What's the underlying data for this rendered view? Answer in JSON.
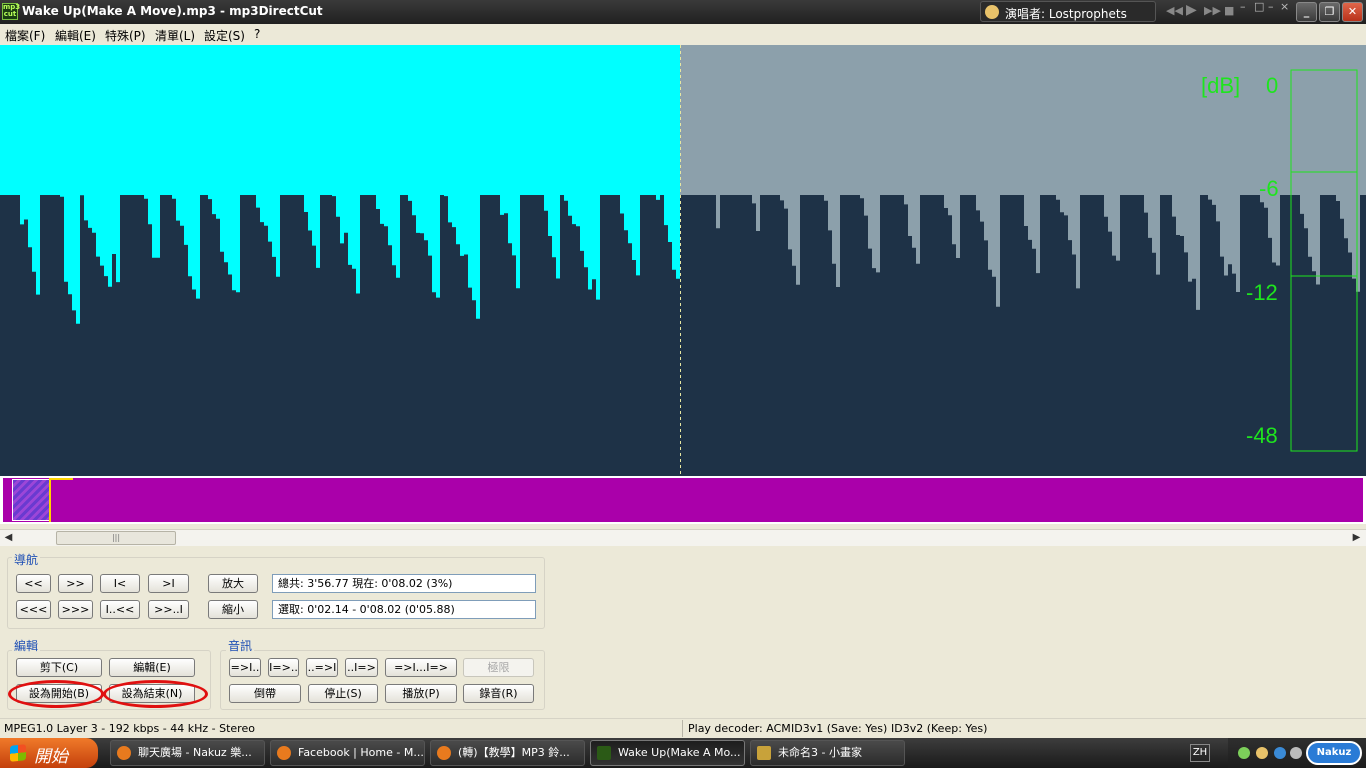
{
  "window": {
    "title": "Wake Up(Make A Move).mp3 - mp3DirectCut",
    "app_icon_text": "mp3 cut"
  },
  "now_playing": {
    "text": "演唱者: Lostprophets"
  },
  "menu": [
    "檔案(F)",
    "編輯(E)",
    "特殊(P)",
    "清單(L)",
    "設定(S)",
    "?"
  ],
  "waveform": {
    "played_color": "#00ffff",
    "unplayed_color": "#8ca0ab",
    "wave_color": "#1e3247",
    "meter_color": "#1ee51e",
    "db_labels": [
      "[dB]",
      "0",
      "-6",
      "-12",
      "-48"
    ]
  },
  "overview": {
    "bar_color": "#aa00aa"
  },
  "navigation": {
    "label": "導航",
    "row1": [
      "<<",
      ">>",
      "I<",
      ">I"
    ],
    "row2": [
      "<<<",
      ">>>",
      "I..<<",
      ">>..I"
    ],
    "zoom_in": "放大",
    "zoom_out": "縮小",
    "total_info": "總共: 3'56.77   現在: 0'08.02   (3%)",
    "selection_info": "選取: 0'02.14 - 0'08.02 (0'05.88)"
  },
  "edit": {
    "label": "編輯",
    "cut": "剪下(C)",
    "edit": "編輯(E)",
    "set_start": "設為開始(B)",
    "set_end": "設為結束(N)"
  },
  "audio": {
    "label": "音訊",
    "row1": [
      "=>I..",
      "I=>..",
      "..=>I",
      "..I=>",
      "=>I...I=>"
    ],
    "limit": "極限",
    "pause": "倒帶",
    "stop": "停止(S)",
    "play": "播放(P)",
    "record": "錄音(R)"
  },
  "status": {
    "format": "MPEG1.0 Layer 3 - 192 kbps - 44 kHz - Stereo",
    "decoder": "Play decoder: ACM",
    "id3v1": "ID3v1 (Save: Yes)",
    "id3v2": "ID3v2 (Keep: Yes)"
  },
  "taskbar": {
    "start": "開始",
    "tasks": [
      "聊天廣場 - Nakuz 樂...",
      "Facebook | Home - M...",
      "(轉)【教學】MP3 鈴...",
      "Wake Up(Make A Mo...",
      "未命名3 - 小畫家"
    ],
    "lang": "ZH",
    "tray_logo": "Nakuz"
  }
}
